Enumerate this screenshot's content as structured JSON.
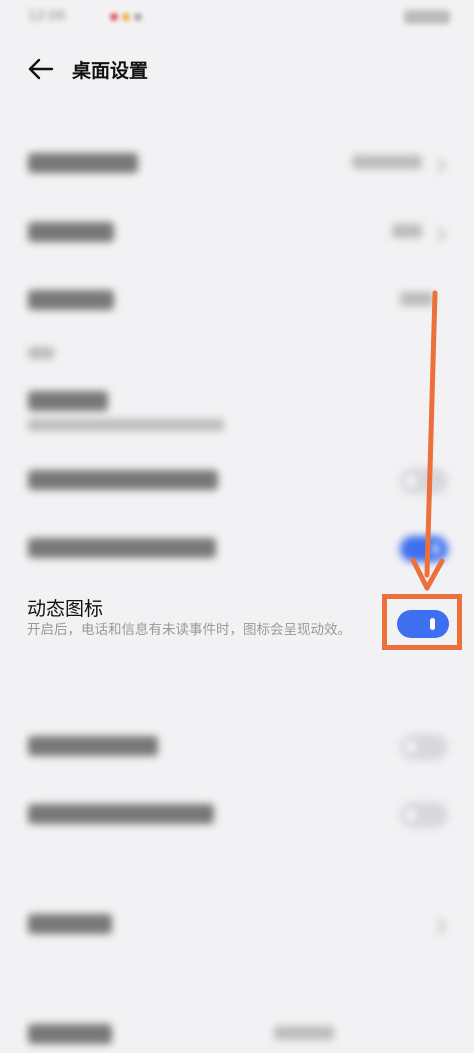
{
  "header": {
    "title": "桌面设置"
  },
  "dynamic_icon": {
    "title": "动态图标",
    "description": "开启后，电话和信息有未读事件时，图标会呈现动效。",
    "enabled": true
  },
  "colors": {
    "accent": "#3d6ff0",
    "highlight": "#ec6f3c",
    "background": "#f2f2f4"
  }
}
